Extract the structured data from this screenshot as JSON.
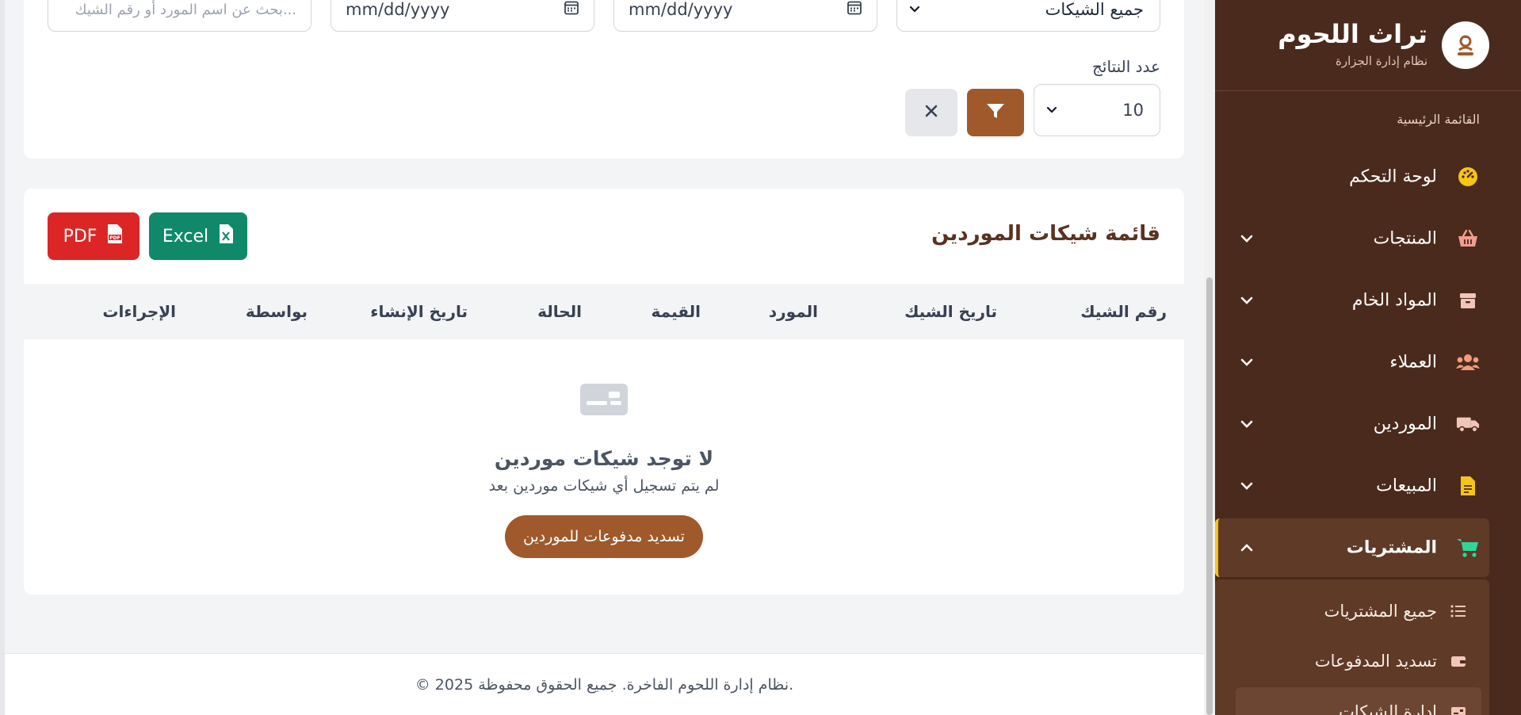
{
  "brand": {
    "title": "تراث اللحوم",
    "subtitle": "نظام إدارة الجزارة",
    "logo_icon": "butcher-icon"
  },
  "sidebar": {
    "heading": "القائمة الرئيسية",
    "items": [
      {
        "label": "لوحة التحكم",
        "icon": "dashboard-icon",
        "icon_color": "#f5c518"
      },
      {
        "label": "المنتجات",
        "icon": "basket-icon",
        "icon_color": "#f29c8f"
      },
      {
        "label": "المواد الخام",
        "icon": "box-icon",
        "icon_color": "#f1c6b8"
      },
      {
        "label": "العملاء",
        "icon": "users-icon",
        "icon_color": "#f29c7a"
      },
      {
        "label": "الموردين",
        "icon": "truck-icon",
        "icon_color": "#f1c6b8"
      },
      {
        "label": "المبيعات",
        "icon": "invoice-icon",
        "icon_color": "#f5c518"
      },
      {
        "label": "المشتريات",
        "icon": "cart-icon",
        "icon_color": "#34d399"
      }
    ],
    "submenu": [
      {
        "label": "جميع المشتريات",
        "icon": "list-icon"
      },
      {
        "label": "تسديد المدفوعات",
        "icon": "wallet-icon"
      },
      {
        "label": "إدارة الشيكات",
        "icon": "check-icon"
      }
    ]
  },
  "filters": {
    "search_placeholder": "بحث عن اسم المورد أو رقم الشيك...",
    "date_from": "mm/dd/yyyy",
    "date_to": "mm/dd/yyyy",
    "status_select": "جميع الشيكات",
    "results_label": "عدد النتائج",
    "results_value": "10"
  },
  "list": {
    "title": "قائمة شيكات الموردين",
    "excel_label": "Excel",
    "pdf_label": "PDF",
    "columns": [
      "رقم الشيك",
      "تاريخ الشيك",
      "المورد",
      "القيمة",
      "الحالة",
      "تاريخ الإنشاء",
      "بواسطة",
      "الإجراءات"
    ],
    "empty_title": "لا توجد شيكات موردين",
    "empty_subtitle": "لم يتم تسجيل أي شيكات موردين بعد",
    "empty_button": "تسديد مدفوعات للموردين"
  },
  "footer": {
    "text": "© 2025 نظام إدارة اللحوم الفاخرة. جميع الحقوق محفوظة."
  },
  "colors": {
    "sidebar_bg": "#4a2a1c",
    "accent": "#a0592a",
    "excel": "#10896a",
    "pdf": "#dc2626"
  }
}
